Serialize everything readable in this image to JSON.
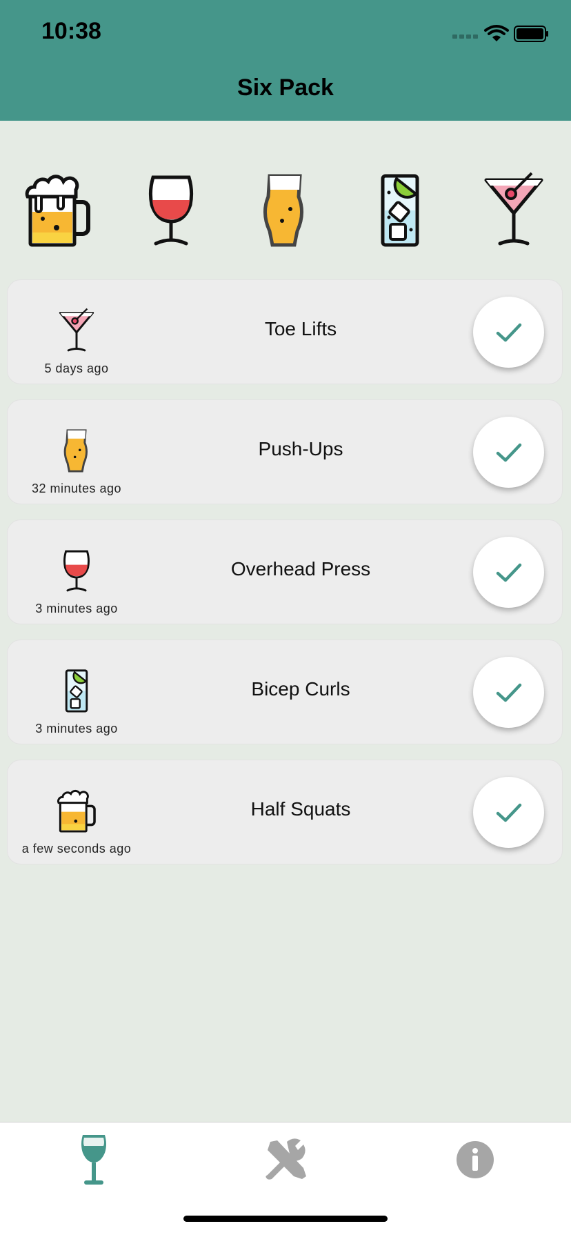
{
  "status_bar": {
    "time": "10:38"
  },
  "header": {
    "title": "Six Pack"
  },
  "drink_picker": [
    {
      "name": "beer-mug"
    },
    {
      "name": "wine-glass"
    },
    {
      "name": "pint-glass"
    },
    {
      "name": "gin-tonic"
    },
    {
      "name": "martini"
    }
  ],
  "exercises": [
    {
      "title": "Toe Lifts",
      "time": "5 days ago",
      "drink": "martini"
    },
    {
      "title": "Push-Ups",
      "time": "32 minutes ago",
      "drink": "pint-glass"
    },
    {
      "title": "Overhead Press",
      "time": "3 minutes ago",
      "drink": "wine-glass"
    },
    {
      "title": "Bicep Curls",
      "time": "3 minutes ago",
      "drink": "gin-tonic"
    },
    {
      "title": "Half Squats",
      "time": "a few seconds ago",
      "drink": "beer-mug"
    }
  ],
  "tabs": [
    {
      "name": "drinks-tab",
      "icon": "wine-glass-icon",
      "active": true
    },
    {
      "name": "tools-tab",
      "icon": "tools-icon",
      "active": false
    },
    {
      "name": "info-tab",
      "icon": "info-icon",
      "active": false
    }
  ],
  "colors": {
    "accent": "#45968a",
    "background": "#e5ebe4",
    "card": "#ededed",
    "tab_inactive": "#a6a6a6"
  }
}
